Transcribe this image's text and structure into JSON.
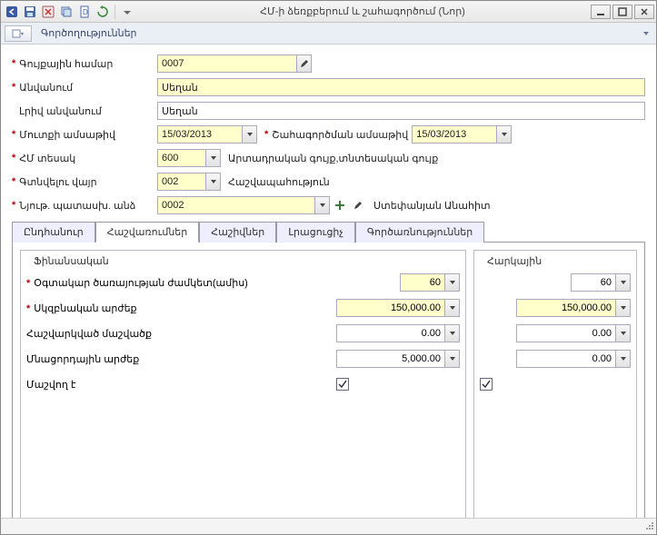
{
  "window": {
    "title": "ՀՄ-ի ձեռքբերում և շահագործում (Նոր)"
  },
  "toolbar": {
    "label": "Գործողություններ"
  },
  "form": {
    "asset_number_label": "Գույքային համար",
    "asset_number": "0007",
    "name_label": "Անվանում",
    "name": "Սեղան",
    "full_name_label": "Լրիվ անվանում",
    "full_name": "Սեղան",
    "entry_date_label": "Մուտքի ամսաթիվ",
    "entry_date": "15/03/2013",
    "operation_date_label": "Շահագործման ամսաթիվ",
    "operation_date": "15/03/2013",
    "asset_type_label": "ՀՄ տեսակ",
    "asset_type_value": "600",
    "asset_type_text": "Արտադրական գույք,տնտեսական գույք",
    "location_label": "Գտնվելու վայր",
    "location_value": "002",
    "location_text": "Հաշվապահություն",
    "responsible_label": "Նյութ. պատասխ. անձ",
    "responsible_value": "0002",
    "responsible_text": "Ստեփանյան Անահիտ"
  },
  "tabs": {
    "general": "Ընդհանուր",
    "calculations": "Հաշվառումներ",
    "accounts": "Հաշիվներ",
    "additional": "Լրացուցիչ",
    "activities": "Գործառնություններ"
  },
  "financial": {
    "title": "Ֆինանսական",
    "useful_life_label": "Օգտակար ծառայության ժամկետ(ամիս)",
    "useful_life": "60",
    "initial_value_label": "Սկզբնական արժեք",
    "initial_value": "150,000.00",
    "calculated_depreciation_label": "Հաշվարկված մաշվածք",
    "calculated_depreciation": "0.00",
    "residual_value_label": "Մնացորդային արժեք",
    "residual_value": "5,000.00",
    "depreciate_label": "Մաշվող է",
    "depreciate_checked": true
  },
  "tax": {
    "title": "Հարկային",
    "useful_life": "60",
    "initial_value": "150,000.00",
    "calculated_depreciation": "0.00",
    "residual_value": "0.00",
    "depreciate_checked": true
  }
}
